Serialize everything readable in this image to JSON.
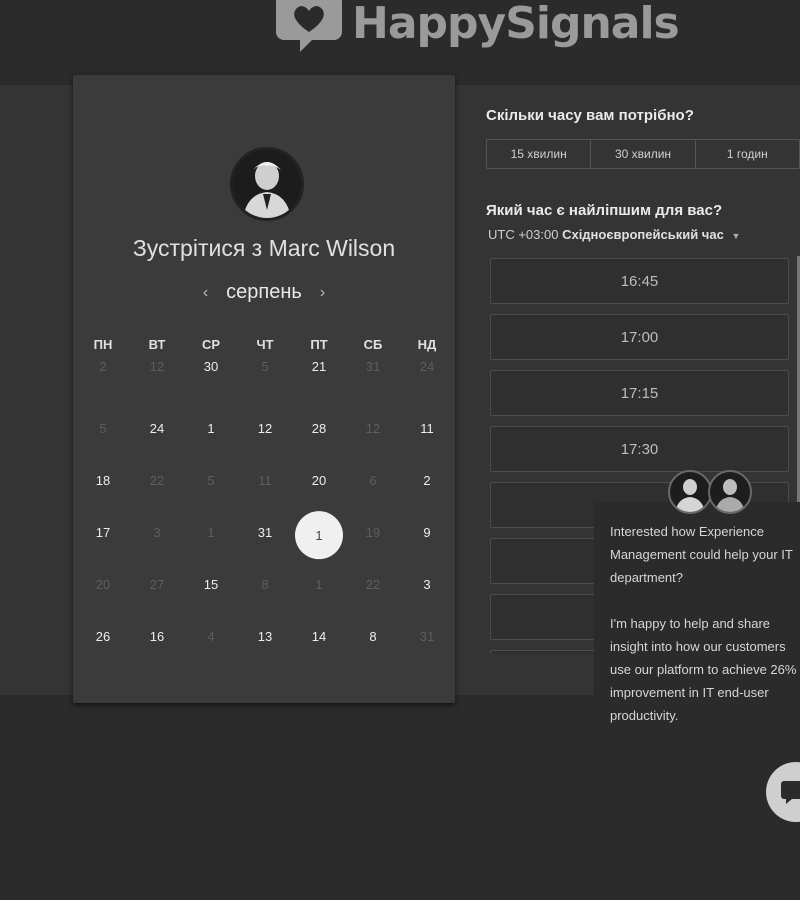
{
  "brand": {
    "name": "HappySignals",
    "icon": "heart-chat-icon"
  },
  "calendar": {
    "title_prefix": "Зустрітися з",
    "host": "Marc Wilson",
    "month": "серпень",
    "prev_icon": "‹",
    "next_icon": "›",
    "weekdays": [
      "ПН",
      "ВТ",
      "СР",
      "ЧТ",
      "ПТ",
      "СБ",
      "НД"
    ],
    "rows": [
      [
        {
          "d": "2",
          "s": "dim"
        },
        {
          "d": "12",
          "s": "dim"
        },
        {
          "d": "30",
          "s": "en"
        },
        {
          "d": "5",
          "s": "dim"
        },
        {
          "d": "21",
          "s": "en"
        },
        {
          "d": "31",
          "s": "dim"
        },
        {
          "d": "24",
          "s": "dim"
        }
      ],
      [
        {
          "d": "5",
          "s": "dim"
        },
        {
          "d": "24",
          "s": "en"
        },
        {
          "d": "1",
          "s": "en"
        },
        {
          "d": "12",
          "s": "en"
        },
        {
          "d": "28",
          "s": "en"
        },
        {
          "d": "12",
          "s": "dim"
        },
        {
          "d": "11",
          "s": "en"
        }
      ],
      [
        {
          "d": "18",
          "s": "en"
        },
        {
          "d": "22",
          "s": "dim"
        },
        {
          "d": "5",
          "s": "dim"
        },
        {
          "d": "11",
          "s": "dim"
        },
        {
          "d": "20",
          "s": "en"
        },
        {
          "d": "6",
          "s": "dim"
        },
        {
          "d": "2",
          "s": "en"
        }
      ],
      [
        {
          "d": "17",
          "s": "en"
        },
        {
          "d": "3",
          "s": "dim"
        },
        {
          "d": "1",
          "s": "dim"
        },
        {
          "d": "31",
          "s": "en"
        },
        {
          "d": "1",
          "s": "sel"
        },
        {
          "d": "19",
          "s": "dim"
        },
        {
          "d": "9",
          "s": "en"
        }
      ],
      [
        {
          "d": "20",
          "s": "dim"
        },
        {
          "d": "27",
          "s": "dim"
        },
        {
          "d": "15",
          "s": "en"
        },
        {
          "d": "8",
          "s": "dim"
        },
        {
          "d": "1",
          "s": "dim"
        },
        {
          "d": "22",
          "s": "dim"
        },
        {
          "d": "3",
          "s": "en"
        }
      ],
      [
        {
          "d": "26",
          "s": "en"
        },
        {
          "d": "16",
          "s": "en"
        },
        {
          "d": "4",
          "s": "dim"
        },
        {
          "d": "13",
          "s": "en"
        },
        {
          "d": "14",
          "s": "en"
        },
        {
          "d": "8",
          "s": "en"
        },
        {
          "d": "31",
          "s": "dim"
        }
      ]
    ]
  },
  "duration": {
    "question": "Скільки часу вам потрібно?",
    "options": [
      "15 хвилин",
      "30 хвилин",
      "1 годин"
    ]
  },
  "time": {
    "question": "Який час є найліпшим для вас?",
    "tz_offset": "UTC +03:00",
    "tz_name": "Східноєвропейський час",
    "slots": [
      "16:45",
      "17:00",
      "17:15",
      "17:30",
      "",
      "",
      "",
      ""
    ]
  },
  "chat": {
    "message": "Interested how Experience Management could help your IT department?\n\nI'm happy to help and share insight into how our customers use our platform to achieve 26% improvement in IT end-user productivity.",
    "launcher_icon": "chat-bubble-icon"
  }
}
